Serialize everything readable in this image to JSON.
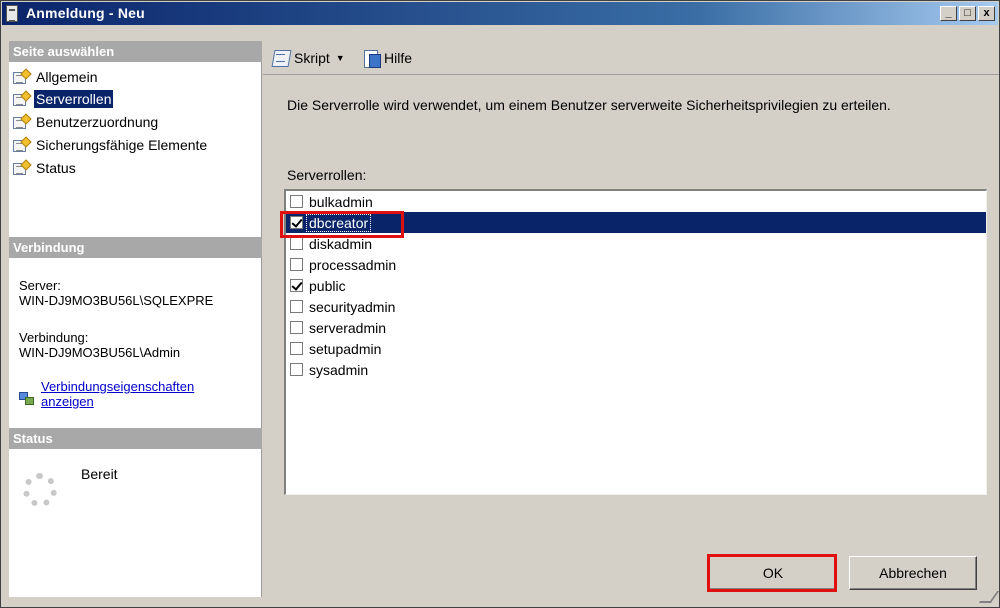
{
  "window": {
    "title": "Anmeldung - Neu",
    "controls": {
      "minimize": "_",
      "maximize": "□",
      "close": "x"
    }
  },
  "sidebar": {
    "select_header": "Seite auswählen",
    "items": [
      {
        "label": "Allgemein",
        "selected": false
      },
      {
        "label": "Serverrollen",
        "selected": true
      },
      {
        "label": "Benutzerzuordnung",
        "selected": false
      },
      {
        "label": "Sicherungsfähige Elemente",
        "selected": false
      },
      {
        "label": "Status",
        "selected": false
      }
    ],
    "connection_header": "Verbindung",
    "server_label": "Server:",
    "server_value": "WIN-DJ9MO3BU56L\\SQLEXPRE",
    "connection_label": "Verbindung:",
    "connection_value": "WIN-DJ9MO3BU56L\\Admin",
    "connection_link_line1": "Verbindungseigenschaften",
    "connection_link_line2": "anzeigen",
    "status_header": "Status",
    "status_value": "Bereit"
  },
  "toolbar": {
    "script_label": "Skript",
    "help_label": "Hilfe"
  },
  "main": {
    "description": "Die Serverrolle wird verwendet, um einem Benutzer serverweite Sicherheitsprivilegien zu erteilen.",
    "roles_label": "Serverrollen:",
    "roles": [
      {
        "name": "bulkadmin",
        "checked": false,
        "selected": false
      },
      {
        "name": "dbcreator",
        "checked": true,
        "selected": true
      },
      {
        "name": "diskadmin",
        "checked": false,
        "selected": false
      },
      {
        "name": "processadmin",
        "checked": false,
        "selected": false
      },
      {
        "name": "public",
        "checked": true,
        "selected": false
      },
      {
        "name": "securityadmin",
        "checked": false,
        "selected": false
      },
      {
        "name": "serveradmin",
        "checked": false,
        "selected": false
      },
      {
        "name": "setupadmin",
        "checked": false,
        "selected": false
      },
      {
        "name": "sysadmin",
        "checked": false,
        "selected": false
      }
    ]
  },
  "buttons": {
    "ok": "OK",
    "cancel": "Abbrechen"
  },
  "colors": {
    "title_gradient_start": "#0a246a",
    "selection": "#0a246a",
    "highlight_box": "#e01010",
    "section_header": "#a8a8a8",
    "link": "#0000cc"
  }
}
